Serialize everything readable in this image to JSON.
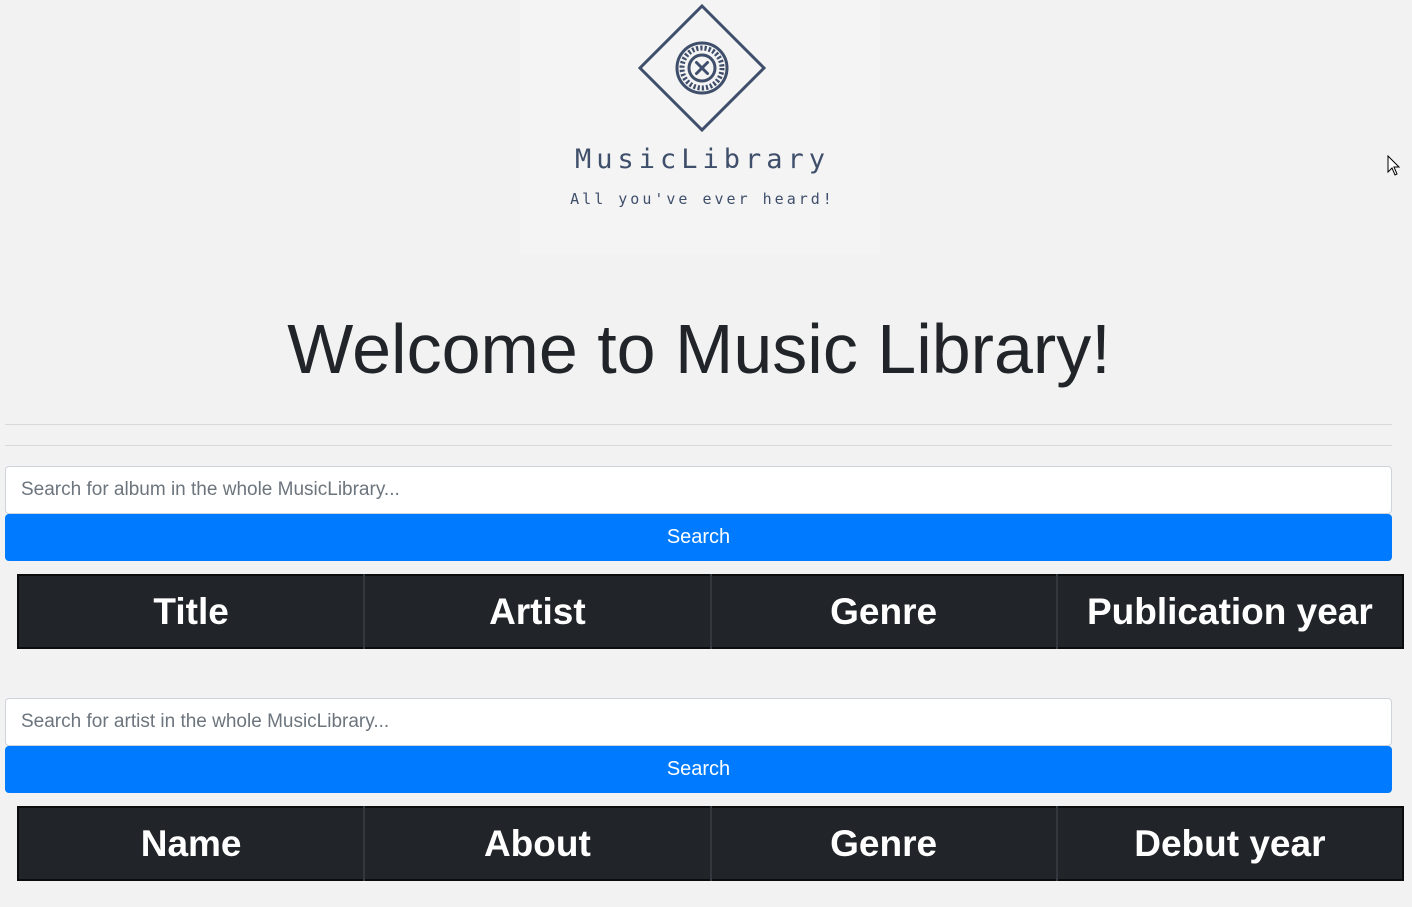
{
  "logo": {
    "icon": "disc-diamond-logo-icon",
    "name": "MusicLibrary",
    "tagline": "All you've ever heard!"
  },
  "welcome_heading": "Welcome to Music Library!",
  "album_search": {
    "placeholder": "Search for album in the whole MusicLibrary...",
    "value": "",
    "button_label": "Search",
    "table_headers": [
      "Title",
      "Artist",
      "Genre",
      "Publication year"
    ]
  },
  "artist_search": {
    "placeholder": "Search for artist in the whole MusicLibrary...",
    "value": "",
    "button_label": "Search",
    "table_headers": [
      "Name",
      "About",
      "Genre",
      "Debut year"
    ]
  },
  "colors": {
    "background": "#f2f2f2",
    "logo_ink": "#3f4f6b",
    "primary_button": "#007bff",
    "table_header": "#212529",
    "heading_text": "#212529"
  }
}
